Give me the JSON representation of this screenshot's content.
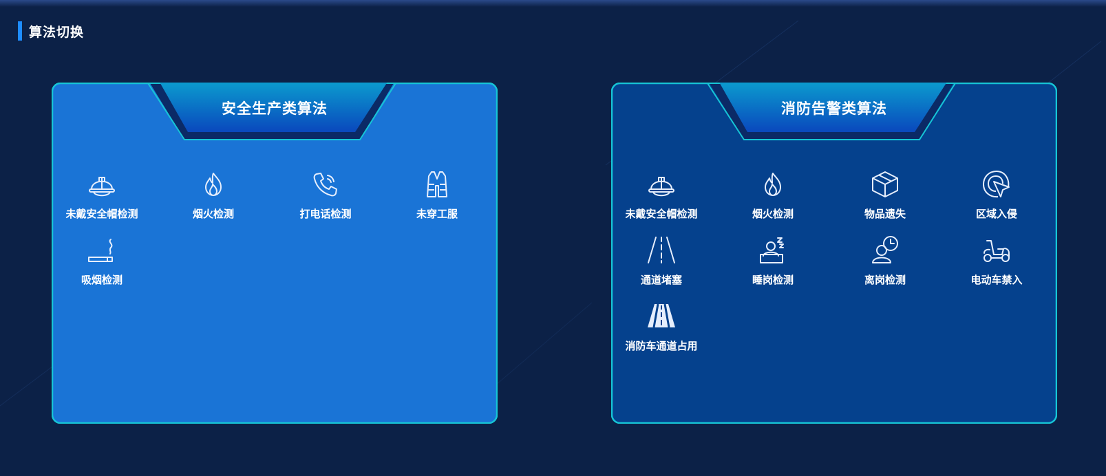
{
  "page": {
    "title": "算法切换"
  },
  "panels": [
    {
      "title": "安全生产类算法",
      "fill": "#1a74d6",
      "items": [
        {
          "label": "未戴安全帽检测",
          "icon": "helmet-icon"
        },
        {
          "label": "烟火检测",
          "icon": "fire-icon"
        },
        {
          "label": "打电话检测",
          "icon": "phone-call-icon"
        },
        {
          "label": "未穿工服",
          "icon": "vest-icon"
        },
        {
          "label": "吸烟检测",
          "icon": "cigarette-icon"
        }
      ]
    },
    {
      "title": "消防告警类算法",
      "fill": "#05418d",
      "items": [
        {
          "label": "未戴安全帽检测",
          "icon": "helmet-icon"
        },
        {
          "label": "烟火检测",
          "icon": "fire-icon"
        },
        {
          "label": "物品遗失",
          "icon": "box-icon"
        },
        {
          "label": "区域入侵",
          "icon": "target-cursor-icon"
        },
        {
          "label": "通道堵塞",
          "icon": "road-lanes-icon"
        },
        {
          "label": "睡岗检测",
          "icon": "sleeping-person-icon"
        },
        {
          "label": "离岗检测",
          "icon": "person-clock-icon"
        },
        {
          "label": "电动车禁入",
          "icon": "scooter-icon"
        },
        {
          "label": "消防车通道占用",
          "icon": "road-icon"
        }
      ]
    }
  ],
  "colors": {
    "background": "#0c2147",
    "accent_bar": "#1e8cff",
    "border": "#16c5d6",
    "tab_top": "#0a93c6",
    "tab_bottom": "#0a4fbf"
  }
}
